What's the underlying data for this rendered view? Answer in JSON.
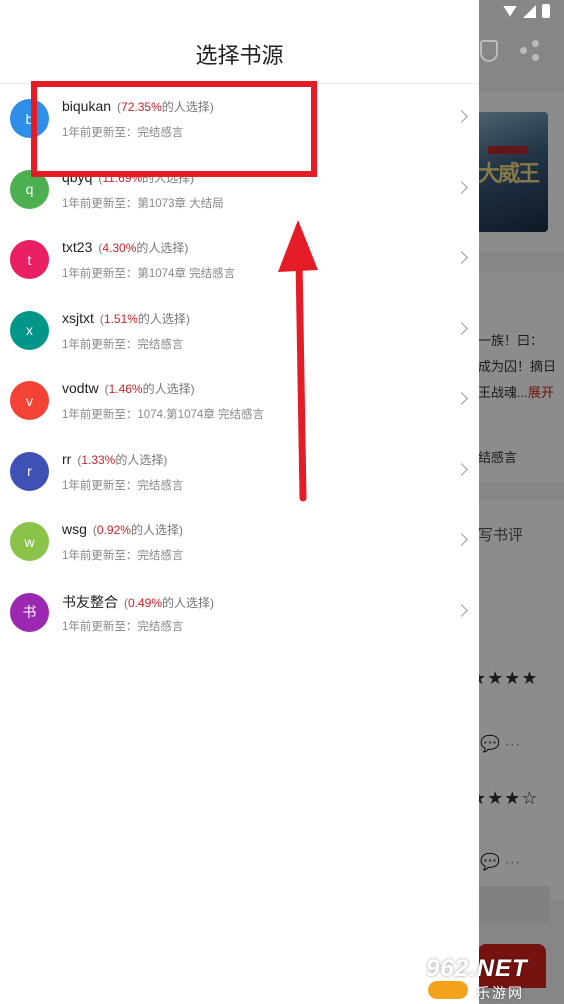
{
  "drawer": {
    "title": "选择书源",
    "sources": [
      {
        "avatar": "b",
        "color": "#2f8fe8",
        "name": "biqukan",
        "percent": "72.35%",
        "suffix": "的人选择)",
        "prefix": "(",
        "update": "1年前更新至：完结感言"
      },
      {
        "avatar": "q",
        "color": "#4caf50",
        "name": "qbyq",
        "percent": "11.69%",
        "suffix": "的人选择)",
        "prefix": "(",
        "update": "1年前更新至：第1073章 大结局"
      },
      {
        "avatar": "t",
        "color": "#e91e63",
        "name": "txt23",
        "percent": "4.30%",
        "suffix": "的人选择)",
        "prefix": "(",
        "update": "1年前更新至：第1074章 完结感言"
      },
      {
        "avatar": "x",
        "color": "#009688",
        "name": "xsjtxt",
        "percent": "1.51%",
        "suffix": "的人选择)",
        "prefix": "(",
        "update": "1年前更新至：完结感言"
      },
      {
        "avatar": "v",
        "color": "#f44336",
        "name": "vodtw",
        "percent": "1.46%",
        "suffix": "的人选择)",
        "prefix": "(",
        "update": "1年前更新至：1074.第1074章 完结感言"
      },
      {
        "avatar": "r",
        "color": "#3f51b5",
        "name": "rr",
        "percent": "1.33%",
        "suffix": "的人选择)",
        "prefix": "(",
        "update": "1年前更新至：完结感言"
      },
      {
        "avatar": "w",
        "color": "#8bc34a",
        "name": "wsg",
        "percent": "0.92%",
        "suffix": "的人选择)",
        "prefix": "(",
        "update": "1年前更新至：完结感言"
      },
      {
        "avatar": "书",
        "color": "#9c27b0",
        "name": "书友整合",
        "percent": "0.49%",
        "suffix": "的人选择)",
        "prefix": "(",
        "update": "1年前更新至：完结感言"
      }
    ]
  },
  "background": {
    "cover_title": "大威王",
    "desc_line1": "一族！曰：",
    "desc_line2": "成为囚！摘日",
    "desc_line3": "王战魂...",
    "expand": "展开",
    "chapter": "结感言",
    "write_review": "写书评",
    "stars1": "★★★★",
    "stars2": "★★★☆"
  },
  "watermark": {
    "brand": "962.NET",
    "site": "乐游网"
  }
}
